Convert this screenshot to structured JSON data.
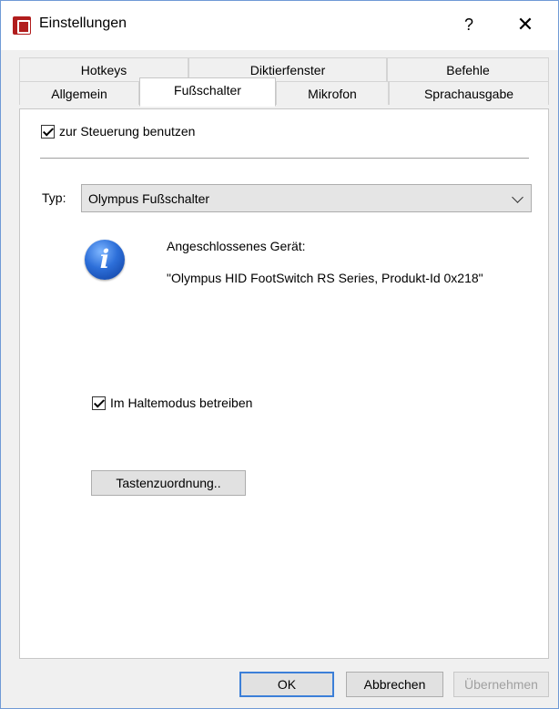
{
  "window": {
    "title": "Einstellungen",
    "help_label": "?",
    "close_label": "✕",
    "app_icon": "app-icon",
    "accent_color": "#3c7fd8"
  },
  "tabs": {
    "row1": [
      {
        "label": "Hotkeys"
      },
      {
        "label": "Diktierfenster"
      },
      {
        "label": "Befehle"
      }
    ],
    "row2": [
      {
        "label": "Allgemein"
      },
      {
        "label": "Fußschalter",
        "active": true
      },
      {
        "label": "Mikrofon"
      },
      {
        "label": "Sprachausgabe"
      }
    ]
  },
  "panel": {
    "use_for_control": {
      "label": "zur Steuerung benutzen",
      "checked": true
    },
    "type": {
      "label": "Typ:",
      "value": "Olympus Fußschalter"
    },
    "device": {
      "icon": "info-icon",
      "heading": "Angeschlossenes Gerät:",
      "name": "\"Olympus HID FootSwitch RS Series, Produkt-Id 0x218\""
    },
    "hold_mode": {
      "label": "Im Haltemodus betreiben",
      "checked": true
    },
    "key_mapping_button": "Tastenzuordnung.."
  },
  "footer": {
    "ok": "OK",
    "cancel": "Abbrechen",
    "apply": "Übernehmen"
  }
}
